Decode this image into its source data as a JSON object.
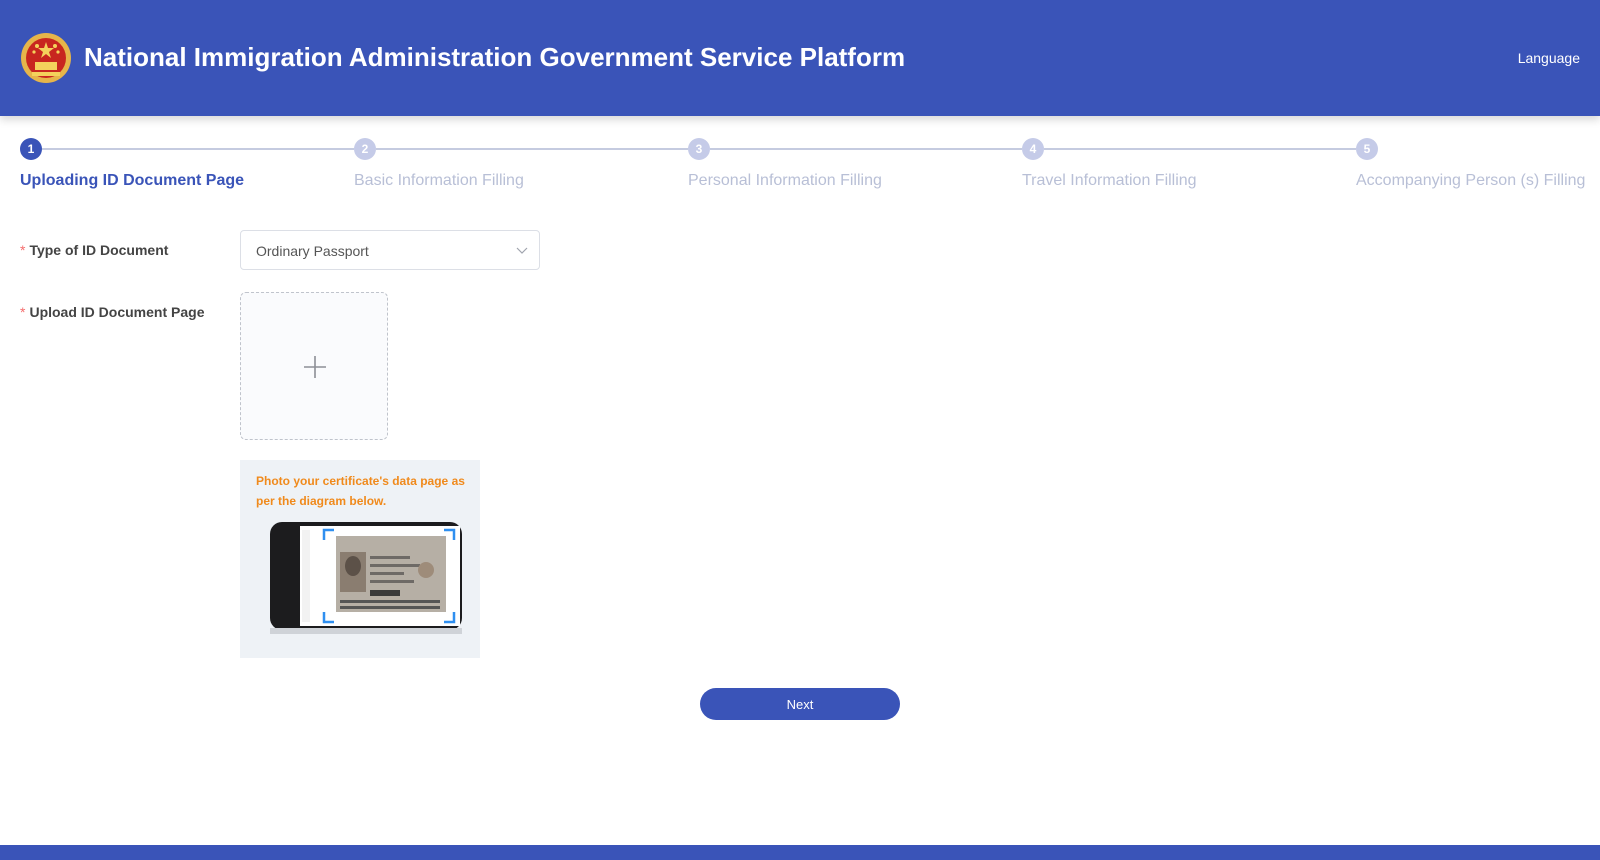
{
  "header": {
    "title": "National Immigration Administration Government Service Platform",
    "language_label": "Language",
    "bg_color": "#3a54b8"
  },
  "steps": [
    {
      "number": "1",
      "label": "Uploading ID Document Page",
      "active": true
    },
    {
      "number": "2",
      "label": "Basic Information Filling",
      "active": false
    },
    {
      "number": "3",
      "label": "Personal Information Filling",
      "active": false
    },
    {
      "number": "4",
      "label": "Travel Information Filling",
      "active": false
    },
    {
      "number": "5",
      "label": "Accompanying Person (s) Filling",
      "active": false
    }
  ],
  "form": {
    "required_mark": "*",
    "doc_type_label": "Type of ID Document",
    "doc_type_value": "Ordinary Passport",
    "upload_label": "Upload ID Document Page",
    "upload_icon": "plus-icon",
    "hint": "Photo your certificate's data page as per the diagram below."
  },
  "actions": {
    "next_label": "Next"
  },
  "colors": {
    "accent": "#3a54b8",
    "hint": "#f08a1c",
    "required": "#f56c6c",
    "inactive_step": "#b8bfd6"
  }
}
